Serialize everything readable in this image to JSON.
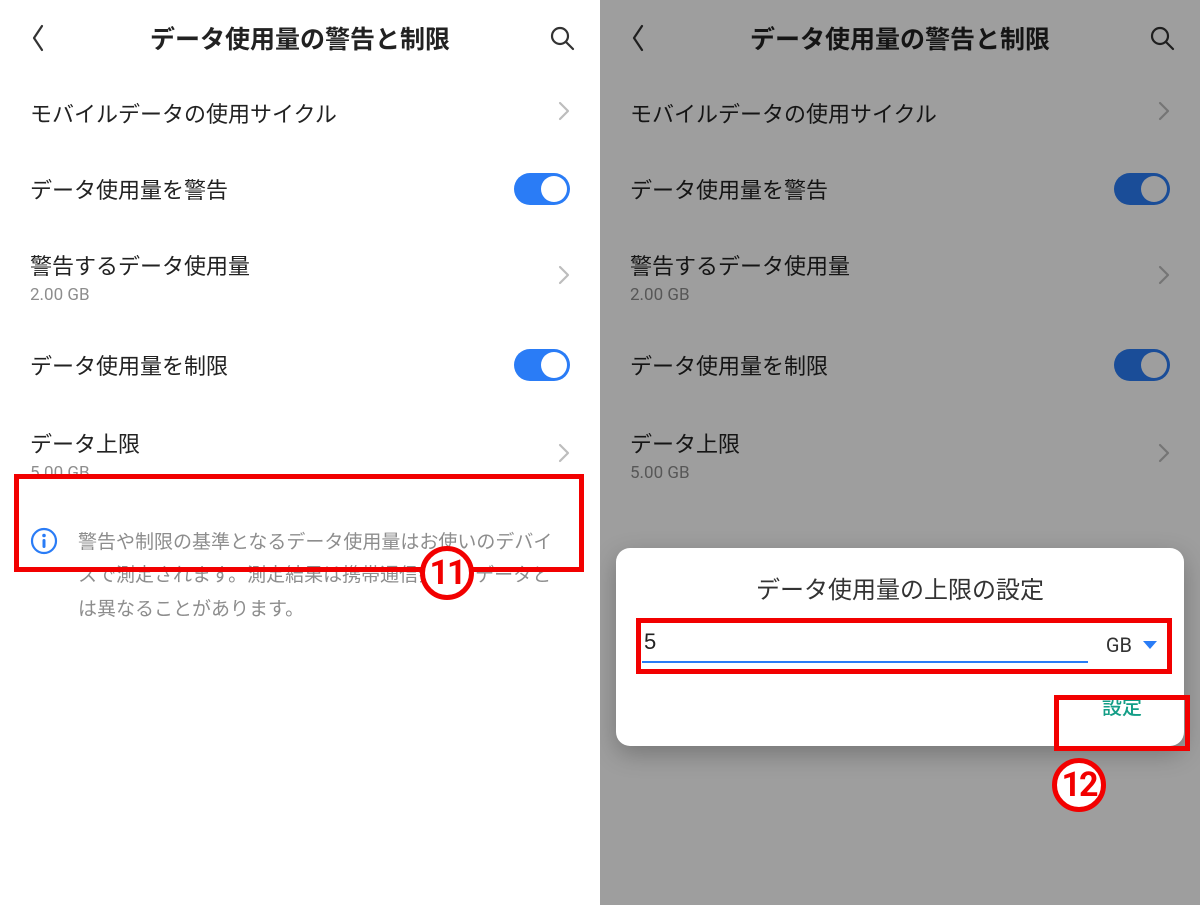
{
  "header": {
    "title": "データ使用量の警告と制限"
  },
  "rows": {
    "cycle": {
      "title": "モバイルデータの使用サイクル"
    },
    "warnToggle": {
      "title": "データ使用量を警告"
    },
    "warnAmount": {
      "title": "警告するデータ使用量",
      "sub": "2.00 GB"
    },
    "limitToggle": {
      "title": "データ使用量を制限"
    },
    "limit": {
      "title": "データ上限",
      "sub": "5.00 GB"
    }
  },
  "info": {
    "text": "警告や制限の基準となるデータ使用量はお使いのデバイスで測定されます。測定結果は携帯通信会社のデータとは異なることがあります。"
  },
  "dialog": {
    "title": "データ使用量の上限の設定",
    "value": "5",
    "unit": "GB",
    "confirm": "設定"
  },
  "callouts": {
    "eleven": "11",
    "twelve": "12"
  }
}
